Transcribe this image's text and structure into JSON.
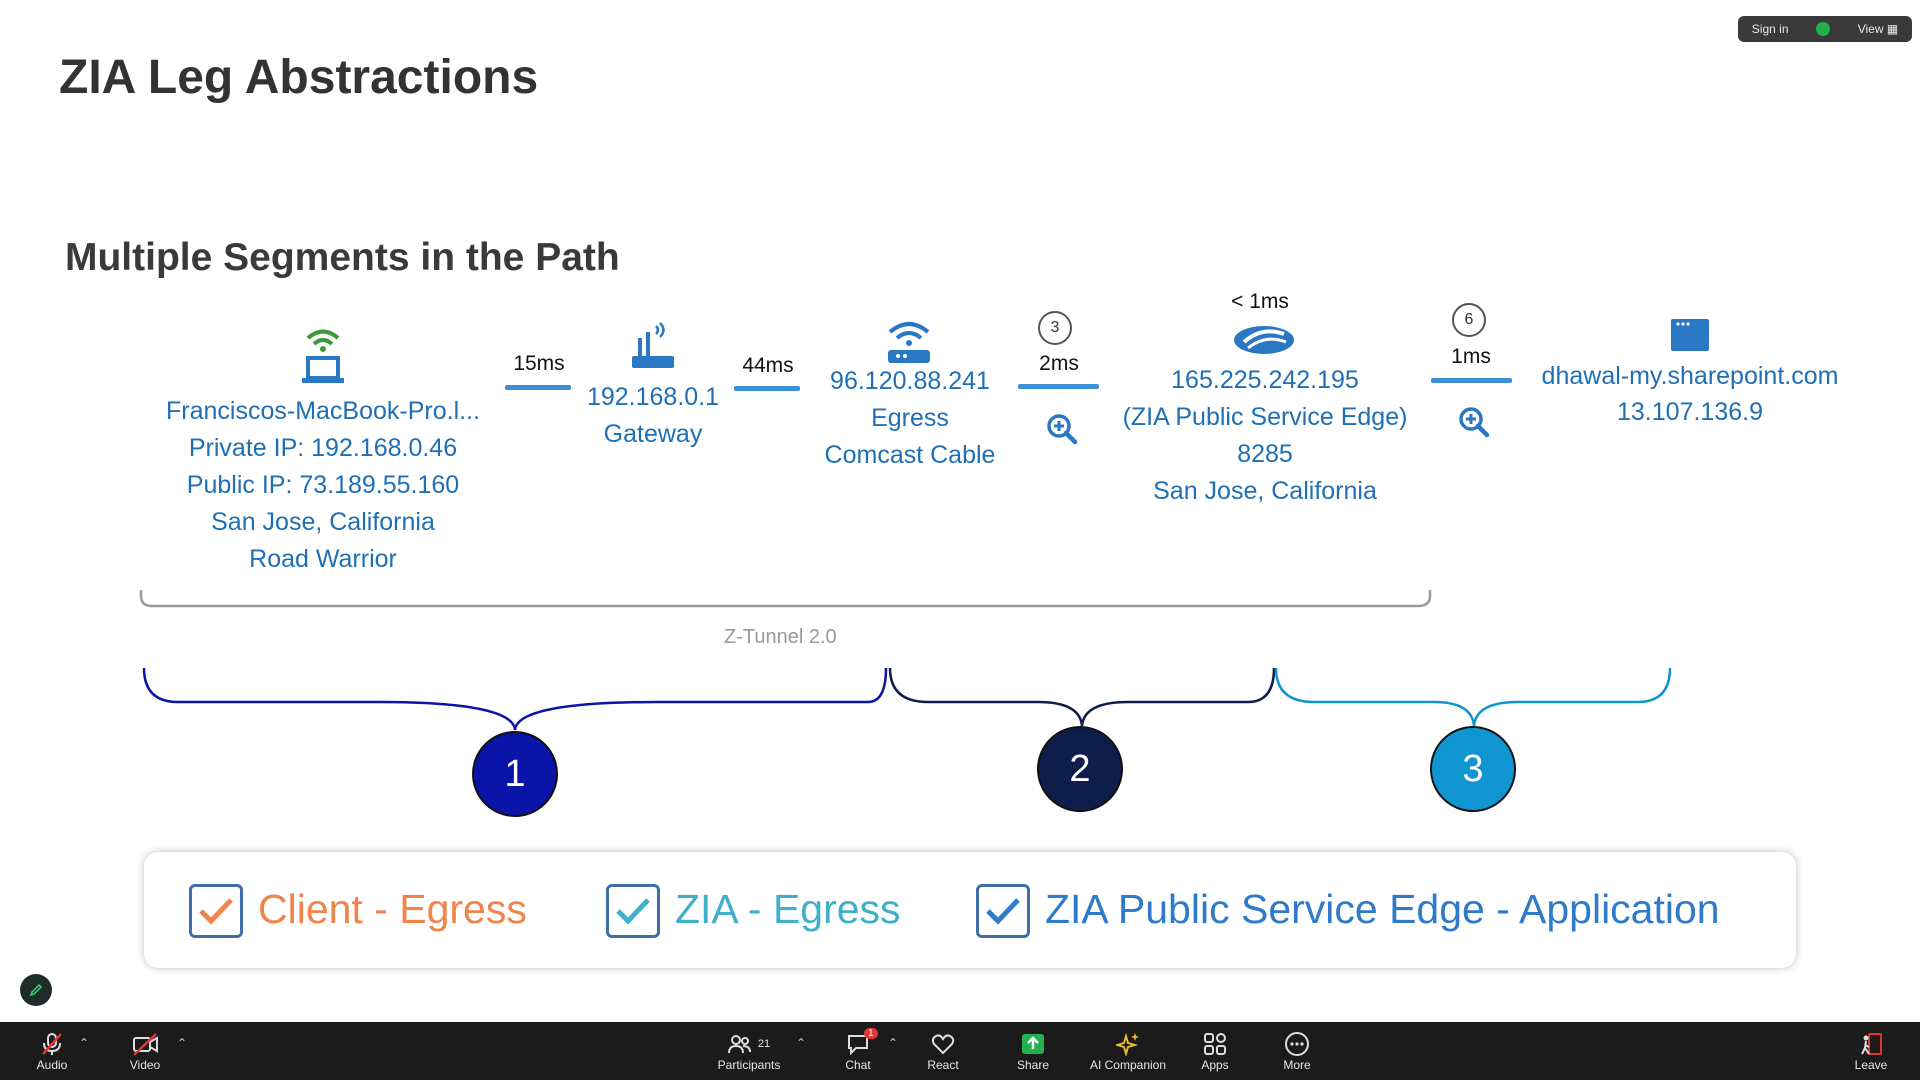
{
  "topbar": {
    "sign_in": "Sign in",
    "view": "View"
  },
  "slide": {
    "title": "ZIA Leg Abstractions",
    "subtitle": "Multiple Segments in the Path",
    "nodes": {
      "client": [
        "Franciscos-MacBook-Pro.l...",
        "Private IP: 192.168.0.46",
        "Public IP: 73.189.55.160",
        "San Jose, California",
        "Road Warrior"
      ],
      "gateway": [
        "192.168.0.1",
        "Gateway"
      ],
      "egress": [
        "96.120.88.241",
        "Egress",
        "Comcast Cable"
      ],
      "edge": [
        "165.225.242.195",
        "(ZIA Public Service Edge)",
        "8285",
        "San Jose, California"
      ],
      "app": [
        "dhawal-my.sharepoint.com",
        "13.107.136.9"
      ]
    },
    "latencies": {
      "l1": "15ms",
      "l2": "44ms",
      "l3": "2ms",
      "l4": "< 1ms",
      "l5": "1ms"
    },
    "hops": {
      "h1": "3",
      "h2": "6"
    },
    "tunnel_label": "Z-Tunnel 2.0",
    "segments": [
      "1",
      "2",
      "3"
    ],
    "segment_colors": [
      "#0a14a8",
      "#0f1d4a",
      "#0f95d0"
    ],
    "checks": [
      {
        "label": "Client - Egress",
        "color": "#f0844a"
      },
      {
        "label": "ZIA - Egress",
        "color": "#3fb0c8"
      },
      {
        "label": "ZIA Public Service Edge - Application",
        "color": "#2f7bc9"
      }
    ]
  },
  "toolbar": {
    "audio": "Audio",
    "video": "Video",
    "participants": "Participants",
    "participants_count": "21",
    "chat": "Chat",
    "chat_badge": "1",
    "react": "React",
    "share": "Share",
    "ai": "AI Companion",
    "apps": "Apps",
    "more": "More",
    "leave": "Leave"
  }
}
